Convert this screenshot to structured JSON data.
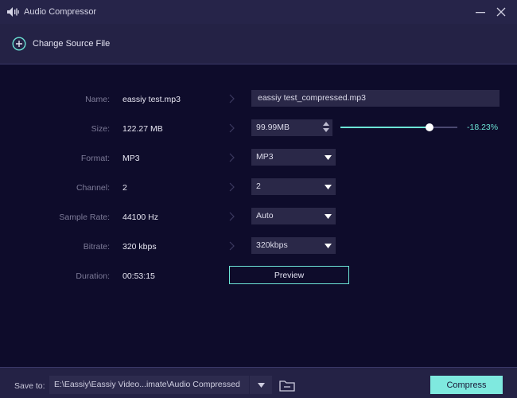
{
  "window": {
    "title": "Audio Compressor",
    "icons": {
      "app": "audio-compressor-icon",
      "minimize": "minimize-icon",
      "close": "close-icon"
    }
  },
  "toolbar": {
    "change_source_label": "Change Source File",
    "change_source_icon": "plus-circle-icon"
  },
  "fields": {
    "name": {
      "label": "Name:",
      "value": "eassiy test.mp3",
      "output": "eassiy test_compressed.mp3"
    },
    "size": {
      "label": "Size:",
      "value": "122.27 MB",
      "output": "99.99MB",
      "percent": "-18.23%",
      "slider_fraction": 0.76
    },
    "format": {
      "label": "Format:",
      "value": "MP3",
      "selected": "MP3"
    },
    "channel": {
      "label": "Channel:",
      "value": "2",
      "selected": "2"
    },
    "sample_rate": {
      "label": "Sample Rate:",
      "value": "44100 Hz",
      "selected": "Auto"
    },
    "bitrate": {
      "label": "Bitrate:",
      "value": "320 kbps",
      "selected": "320kbps"
    },
    "duration": {
      "label": "Duration:",
      "value": "00:53:15"
    }
  },
  "preview_label": "Preview",
  "bottom": {
    "save_to_label": "Save to:",
    "save_path": "E:\\Eassiy\\Eassiy Video...imate\\Audio Compressed",
    "compress_label": "Compress",
    "folder_icon": "folder-icon"
  },
  "colors": {
    "background": "#0e0c2b",
    "panel": "#242245",
    "accent": "#6ce4d6",
    "compress_button": "#7fe9df"
  }
}
